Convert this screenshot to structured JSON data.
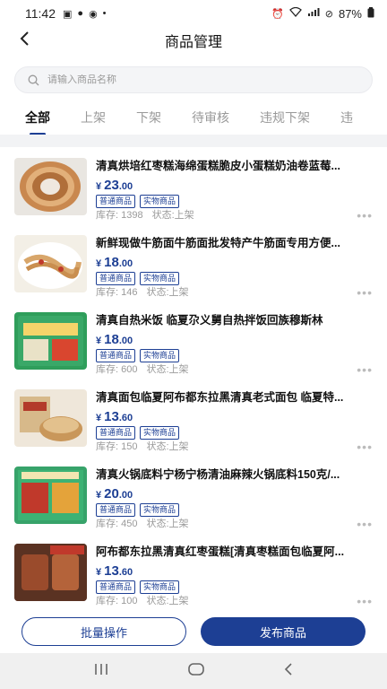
{
  "status_bar": {
    "time": "11:42",
    "battery": "87%"
  },
  "nav": {
    "title": "商品管理",
    "back_icon": "chevron-left-icon"
  },
  "search": {
    "placeholder": "请输入商品名称"
  },
  "tabs": [
    {
      "label": "全部",
      "active": true
    },
    {
      "label": "上架",
      "active": false
    },
    {
      "label": "下架",
      "active": false
    },
    {
      "label": "待审核",
      "active": false
    },
    {
      "label": "违规下架",
      "active": false
    },
    {
      "label": "违",
      "active": false
    }
  ],
  "products": [
    {
      "title": "清真烘培红枣糕海绵蛋糕脆皮小蛋糕奶油卷蓝莓...",
      "price_symbol": "¥",
      "price_int": "23",
      "price_dec": ".00",
      "tags": [
        "普通商品",
        "实物商品"
      ],
      "stock": "库存: 1398",
      "status": "状态:上架"
    },
    {
      "title": "新鲜现做牛筋面牛筋面批发特产牛筋面专用方便...",
      "price_symbol": "¥",
      "price_int": "18",
      "price_dec": ".00",
      "tags": [
        "普通商品",
        "实物商品"
      ],
      "stock": "库存: 146",
      "status": "状态:上架"
    },
    {
      "title": "清真自热米饭 临夏尕义舅自热拌饭回族穆斯林",
      "price_symbol": "¥",
      "price_int": "18",
      "price_dec": ".00",
      "tags": [
        "普通商品",
        "实物商品"
      ],
      "stock": "库存: 600",
      "status": "状态:上架"
    },
    {
      "title": "清真面包临夏阿布都东拉黑清真老式面包 临夏特...",
      "price_symbol": "¥",
      "price_int": "13",
      "price_dec": ".60",
      "tags": [
        "普通商品",
        "实物商品"
      ],
      "stock": "库存: 150",
      "status": "状态:上架"
    },
    {
      "title": "清真火锅底料宁杨宁杨清油麻辣火锅底料150克/...",
      "price_symbol": "¥",
      "price_int": "20",
      "price_dec": ".00",
      "tags": [
        "普通商品",
        "实物商品"
      ],
      "stock": "库存: 450",
      "status": "状态:上架"
    },
    {
      "title": "阿布都东拉黑清真红枣蛋糕[清真枣糕面包临夏阿...",
      "price_symbol": "¥",
      "price_int": "13",
      "price_dec": ".60",
      "tags": [
        "普通商品",
        "实物商品"
      ],
      "stock": "库存: 100",
      "status": "状态:上架"
    }
  ],
  "bottom": {
    "batch_label": "批量操作",
    "publish_label": "发布商品"
  },
  "colors": {
    "accent": "#1d3f94",
    "muted": "#9a9a9a"
  }
}
